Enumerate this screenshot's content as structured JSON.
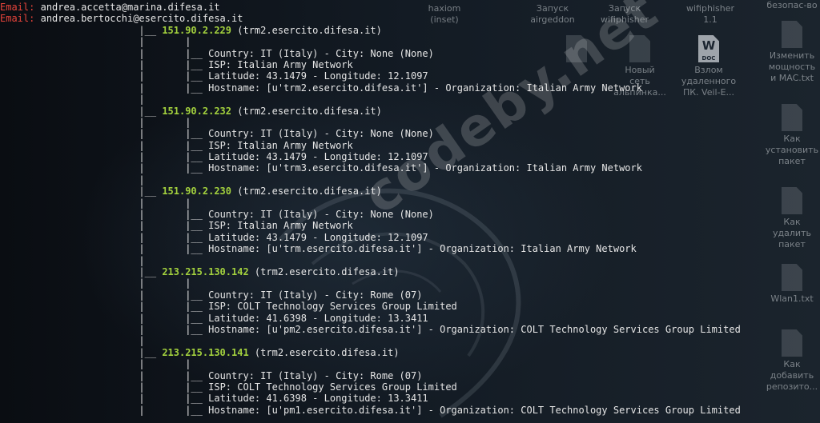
{
  "emails": [
    {
      "label": "Email:",
      "value": "andrea.accetta@marina.difesa.it"
    },
    {
      "label": "Email:",
      "value": "andrea.bertocchi@esercito.difesa.it"
    }
  ],
  "hosts": [
    {
      "ip": "151.90.2.229",
      "host": "(trm2.esercito.difesa.it)",
      "country": "Country: IT (Italy) - City: None (None)",
      "isp": "ISP: Italian Army Network",
      "coords": "Latitude: 43.1479 - Longitude: 12.1097",
      "hostname": "Hostname: [u'trm2.esercito.difesa.it'] - Organization: Italian Army Network"
    },
    {
      "ip": "151.90.2.232",
      "host": "(trm2.esercito.difesa.it)",
      "country": "Country: IT (Italy) - City: None (None)",
      "isp": "ISP: Italian Army Network",
      "coords": "Latitude: 43.1479 - Longitude: 12.1097",
      "hostname": "Hostname: [u'trm3.esercito.difesa.it'] - Organization: Italian Army Network"
    },
    {
      "ip": "151.90.2.230",
      "host": "(trm2.esercito.difesa.it)",
      "country": "Country: IT (Italy) - City: None (None)",
      "isp": "ISP: Italian Army Network",
      "coords": "Latitude: 43.1479 - Longitude: 12.1097",
      "hostname": "Hostname: [u'trm.esercito.difesa.it'] - Organization: Italian Army Network"
    },
    {
      "ip": "213.215.130.142",
      "host": "(trm2.esercito.difesa.it)",
      "country": "Country: IT (Italy) - City: Rome (07)",
      "isp": "ISP: COLT Technology Services Group Limited",
      "coords": "Latitude: 41.6398 - Longitude: 13.3411",
      "hostname": "Hostname: [u'pm2.esercito.difesa.it'] - Organization: COLT Technology Services Group Limited"
    },
    {
      "ip": "213.215.130.141",
      "host": "(trm2.esercito.difesa.it)",
      "country": "Country: IT (Italy) - City: Rome (07)",
      "isp": "ISP: COLT Technology Services Group Limited",
      "coords": "Latitude: 41.6398 - Longitude: 13.3411",
      "hostname": "Hostname: [u'pm1.esercito.difesa.it'] - Organization: COLT Technology Services Group Limited"
    }
  ],
  "tree": {
    "branch": "|__",
    "pipe": "|"
  },
  "watermark": "codeby.net",
  "desktop": {
    "top_items": [
      {
        "label": "haxiom\n(inset)",
        "icon": "file-icon"
      },
      {
        "label": "Запуск\nairgeddon",
        "icon": "file-icon"
      },
      {
        "label": "Запуск\nwifiphisher",
        "icon": "file-icon"
      },
      {
        "label": "wifiphisher\n1.1",
        "icon": "file-icon"
      },
      {
        "label": "Новый\nсеть\nальпинка...",
        "icon": "file-icon"
      },
      {
        "label": "Взлом\nудаленного\nПК. Veil-E...",
        "icon": "word-doc-icon",
        "badge": "W",
        "badge_sub": "DOC"
      }
    ],
    "side_items": [
      {
        "label": "Изменить\nмощность\nи MAC.txt"
      },
      {
        "label": "Как\nустановить\nпакет"
      },
      {
        "label": "Как\nудалить\nпакет"
      },
      {
        "label": "Wlan1.txt"
      },
      {
        "label": "Как\nдобавить\nрепозито..."
      }
    ],
    "corner_label": "безопас-во"
  }
}
